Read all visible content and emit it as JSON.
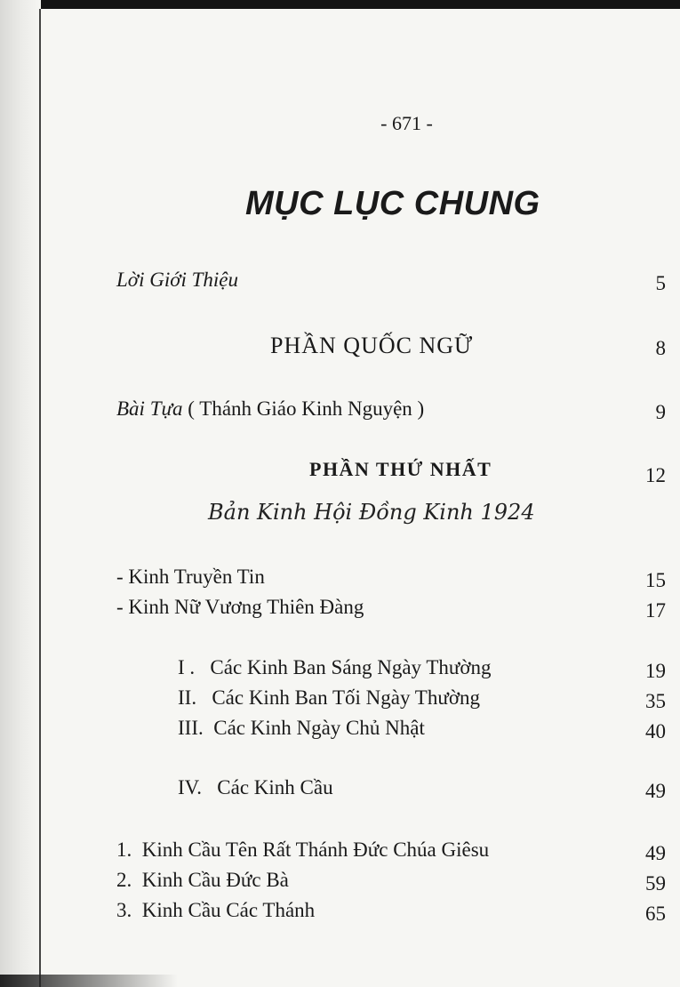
{
  "page_number": "- 671 -",
  "title": "MỤC LỤC CHUNG",
  "entries": [
    {
      "label": "Lời Giới Thiệu",
      "page": "5"
    },
    {
      "label": "PHẦN QUỐC NGỮ",
      "page": "8"
    },
    {
      "label_italic": "Bài Tựa",
      "label_rest": "( Thánh Giáo Kinh Nguyện )",
      "page": "9"
    },
    {
      "label": "PHẦN THỨ NHẤT",
      "page": "12"
    },
    {
      "label": "Bản Kinh Hội Đồng Kinh 1924"
    },
    {
      "label": "- Kinh Truyền Tin",
      "page": "15"
    },
    {
      "label": "- Kinh Nữ Vương Thiên Đàng",
      "page": "17"
    },
    {
      "label": "I .   Các Kinh Ban Sáng Ngày Thường",
      "page": "19"
    },
    {
      "label": "II.   Các Kinh Ban Tối Ngày Thường",
      "page": "35"
    },
    {
      "label": "III.  Các Kinh Ngày Chủ Nhật",
      "page": "40"
    },
    {
      "label": "IV.   Các Kinh Cầu",
      "page": "49"
    },
    {
      "label": "1.  Kinh Cầu Tên Rất Thánh Đức Chúa Giêsu",
      "page": "49"
    },
    {
      "label": "2.  Kinh Cầu Đức Bà",
      "page": "59"
    },
    {
      "label": "3.  Kinh Cầu Các Thánh",
      "page": "65"
    }
  ]
}
